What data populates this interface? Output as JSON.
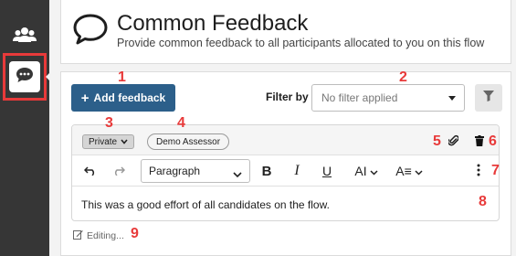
{
  "header": {
    "title": "Common Feedback",
    "subtitle": "Provide common feedback to all participants allocated to you on this flow"
  },
  "toolbar": {
    "add_label": "Add feedback",
    "filter_label": "Filter by",
    "filter_placeholder": "No filter applied"
  },
  "feedback_item": {
    "visibility": "Private",
    "assessor": "Demo Assessor",
    "format_value": "Paragraph",
    "content": "This was a good effort of all candidates on the flow.",
    "status": "Editing..."
  },
  "annotations": [
    "1",
    "2",
    "3",
    "4",
    "5",
    "6",
    "7",
    "8",
    "9"
  ],
  "colors": {
    "accent": "#2c5f8a",
    "annotation": "#e83a3a",
    "sidebar": "#363636"
  }
}
